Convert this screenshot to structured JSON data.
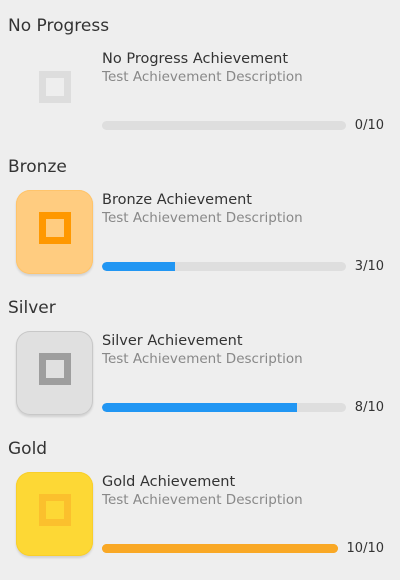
{
  "achievements": [
    {
      "section_title": "No Progress",
      "title": "No Progress Achievement",
      "description": "Test Achievement Description",
      "progress_text": "0/10",
      "progress": 0.0,
      "tier": "none",
      "badge_icon": "square-outline-icon",
      "colors": {
        "badge_bg": "#eeeeee",
        "badge_border": "#eeeeee",
        "icon": "#dddddd",
        "fill": "#2196f3"
      }
    },
    {
      "section_title": "Bronze",
      "title": "Bronze Achievement",
      "description": "Test Achievement Description",
      "progress_text": "3/10",
      "progress": 0.3,
      "tier": "bronze",
      "badge_icon": "square-outline-icon",
      "colors": {
        "badge_bg": "#ffcc80",
        "badge_border": "#ffc46b",
        "icon": "#ff9800",
        "fill": "#2196f3"
      }
    },
    {
      "section_title": "Silver",
      "title": "Silver Achievement",
      "description": "Test Achievement Description",
      "progress_text": "8/10",
      "progress": 0.8,
      "tier": "silver",
      "badge_icon": "square-outline-icon",
      "colors": {
        "badge_bg": "#e0e0e0",
        "badge_border": "#c8c8c8",
        "icon": "#9e9e9e",
        "fill": "#2196f3"
      }
    },
    {
      "section_title": "Gold",
      "title": "Gold Achievement",
      "description": "Test Achievement Description",
      "progress_text": "10/10",
      "progress": 1.0,
      "tier": "gold",
      "badge_icon": "square-outline-icon",
      "colors": {
        "badge_bg": "#fdd835",
        "badge_border": "#f9cf2a",
        "icon": "#fbc02d",
        "fill": "#f9a825"
      }
    }
  ]
}
